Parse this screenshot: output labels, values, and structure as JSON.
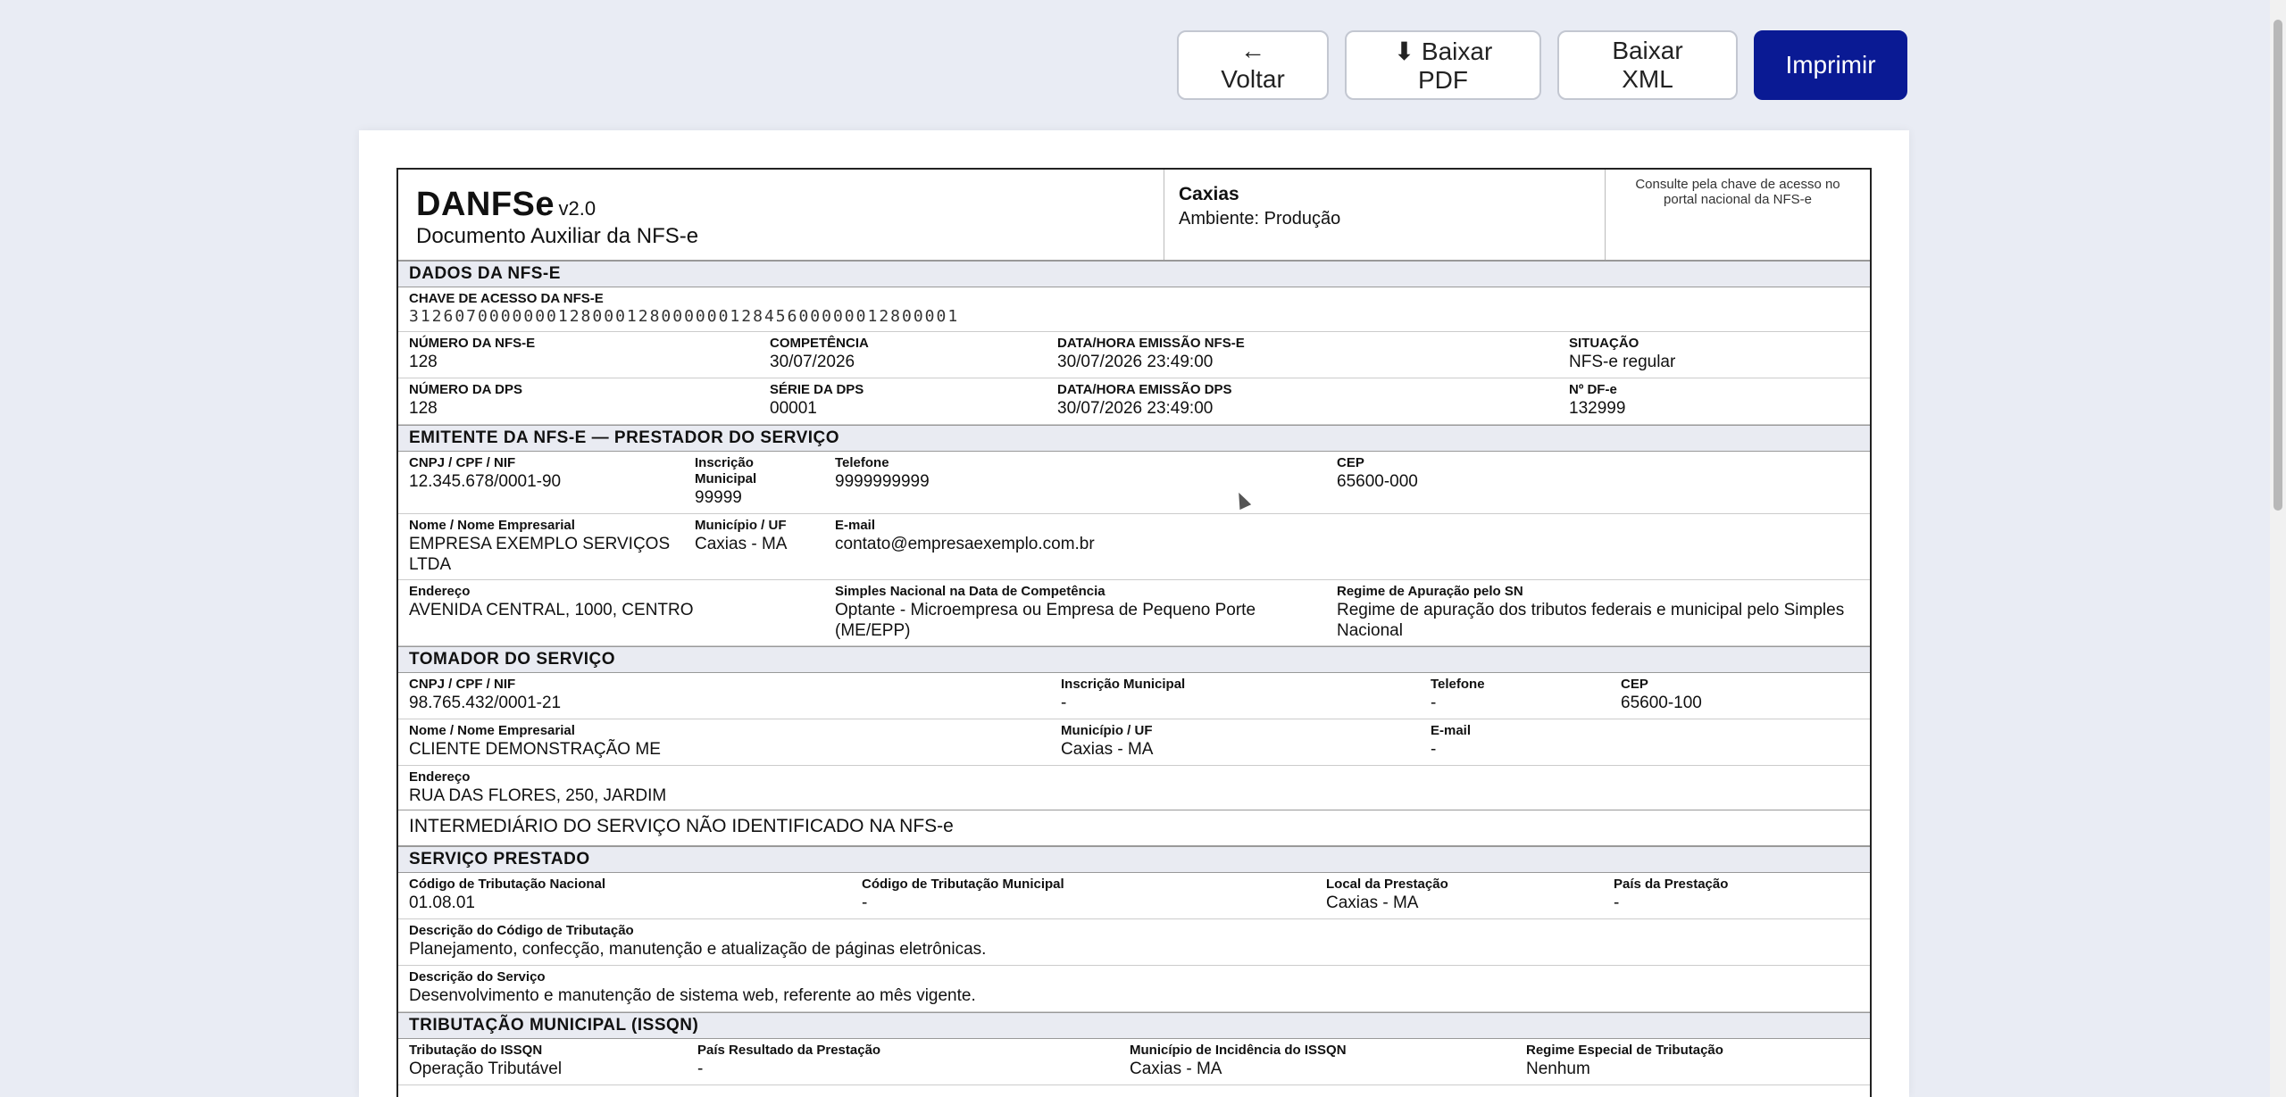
{
  "toolbar": {
    "back": "← Voltar",
    "pdf": "⬇ Baixar PDF",
    "xml": "Baixar XML",
    "print": "Imprimir"
  },
  "header": {
    "title": "DANFSe",
    "version": "v2.0",
    "subtitle": "Documento Auxiliar da NFS-e",
    "municipio": "Caxias",
    "ambiente": "Ambiente: Produção",
    "consulta": "Consulte pela chave de acesso no portal nacional da NFS-e"
  },
  "dados": {
    "section": "DADOS DA NFS-E",
    "chave_label": "CHAVE DE ACESSO DA NFS-E",
    "chave": "31260700000001280001280000001284560000001280000​1",
    "numero_label": "NÚMERO DA NFS-E",
    "numero": "128",
    "competencia_label": "COMPETÊNCIA",
    "competencia": "30/07/2026",
    "emissao_label": "DATA/HORA EMISSÃO NFS-E",
    "emissao": "30/07/2026 23:49:00",
    "situacao_label": "SITUAÇÃO",
    "situacao": "NFS-e regular",
    "dps_label": "NÚMERO DA DPS",
    "dps": "128",
    "serie_label": "SÉRIE DA DPS",
    "serie": "00001",
    "emissao_dps_label": "DATA/HORA EMISSÃO DPS",
    "emissao_dps": "30/07/2026 23:49:00",
    "df_label": "Nº DF-e",
    "df": "132999"
  },
  "emitente": {
    "section": "EMITENTE DA NFS-E — PRESTADOR DO SERVIÇO",
    "cnpj_label": "CNPJ / CPF / NIF",
    "cnpj": "12.345.678/0001-90",
    "im_label": "Inscrição Municipal",
    "im": "99999",
    "tel_label": "Telefone",
    "tel": "9999999999",
    "cep_label": "CEP",
    "cep": "65600-000",
    "nome_label": "Nome / Nome Empresarial",
    "nome": "EMPRESA EXEMPLO SERVIÇOS LTDA",
    "mun_label": "Município / UF",
    "mun": "Caxias - MA",
    "email_label": "E-mail",
    "email": "contato@empresaexemplo.com.br",
    "end_label": "Endereço",
    "end": "AVENIDA CENTRAL, 1000, CENTRO",
    "sn_label": "Simples Nacional na Data de Competência",
    "sn": "Optante - Microempresa ou Empresa de Pequeno Porte (ME/EPP)",
    "regime_label": "Regime de Apuração pelo SN",
    "regime": "Regime de apuração dos tributos federais e municipal pelo Simples Nacional"
  },
  "tomador": {
    "section": "TOMADOR DO SERVIÇO",
    "cnpj_label": "CNPJ / CPF / NIF",
    "cnpj": "98.765.432/0001-21",
    "im_label": "Inscrição Municipal",
    "im": "-",
    "tel_label": "Telefone",
    "tel": "-",
    "cep_label": "CEP",
    "cep": "65600-100",
    "nome_label": "Nome / Nome Empresarial",
    "nome": "CLIENTE DEMONSTRAÇÃO ME",
    "mun_label": "Município / UF",
    "mun": "Caxias - MA",
    "email_label": "E-mail",
    "email": "-",
    "end_label": "Endereço",
    "end": "RUA DAS FLORES, 250, JARDIM"
  },
  "intermediario": "INTERMEDIÁRIO DO SERVIÇO NÃO IDENTIFICADO NA NFS-e",
  "servico": {
    "section": "SERVIÇO PRESTADO",
    "ctn_label": "Código de Tributação Nacional",
    "ctn": "01.08.01",
    "ctm_label": "Código de Tributação Municipal",
    "ctm": "-",
    "local_label": "Local da Prestação",
    "local": "Caxias - MA",
    "pais_label": "País da Prestação",
    "pais": "-",
    "desc_cod_label": "Descrição do Código de Tributação",
    "desc_cod": "Planejamento, confecção, manutenção e atualização de páginas eletrônicas.",
    "desc_serv_label": "Descrição do Serviço",
    "desc_serv": "Desenvolvimento e manutenção de sistema web, referente ao mês vigente."
  },
  "tributacao": {
    "section": "TRIBUTAÇÃO MUNICIPAL (ISSQN)",
    "trib_label": "Tributação do ISSQN",
    "trib": "Operação Tributável",
    "pais_label": "País Resultado da Prestação",
    "pais": "-",
    "mun_label": "Município de Incidência do ISSQN",
    "mun": "Caxias - MA",
    "regime_label": "Regime Especial de Tributação",
    "regime": "Nenhum"
  }
}
